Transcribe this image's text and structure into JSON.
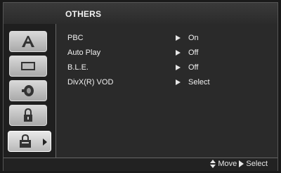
{
  "header": {
    "title": "OTHERS"
  },
  "sidebar": {
    "items": [
      {
        "icon": "a-letter-icon"
      },
      {
        "icon": "display-icon"
      },
      {
        "icon": "speaker-icon"
      },
      {
        "icon": "lock-icon"
      },
      {
        "icon": "others-icon",
        "active": true
      }
    ]
  },
  "settings": [
    {
      "label": "PBC",
      "value": "On"
    },
    {
      "label": "Auto Play",
      "value": "Off"
    },
    {
      "label": "B.L.E.",
      "value": "Off"
    },
    {
      "label": "DivX(R) VOD",
      "value": "Select"
    }
  ],
  "footer": {
    "move_label": "Move",
    "select_label": "Select"
  }
}
